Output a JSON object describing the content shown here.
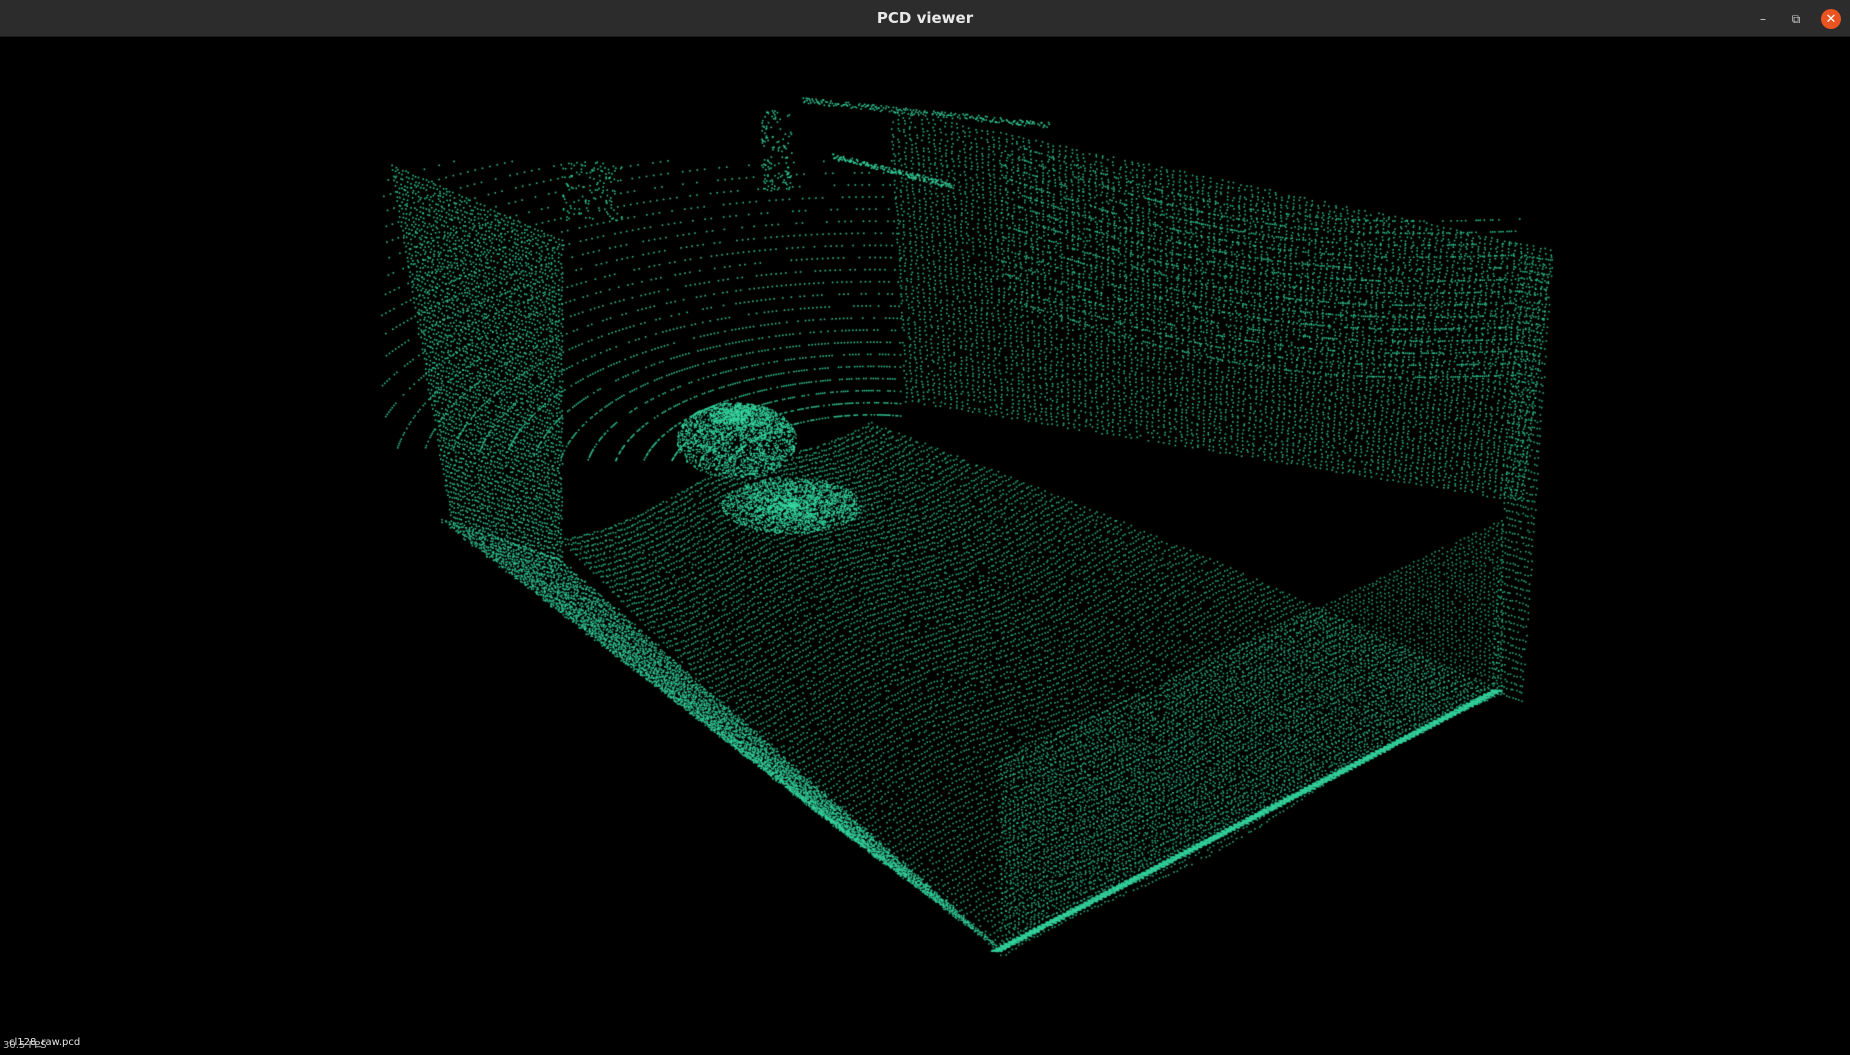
{
  "window": {
    "title": "PCD viewer",
    "controls": {
      "minimize_icon": "minimize-icon",
      "maximize_icon": "maximize-icon",
      "close_icon": "close-icon"
    }
  },
  "viewer": {
    "background_color": "#000000",
    "point_color": "#35d6a0",
    "file_name": "cl128_raw.pcd",
    "fps": "30.5 FPS"
  }
}
